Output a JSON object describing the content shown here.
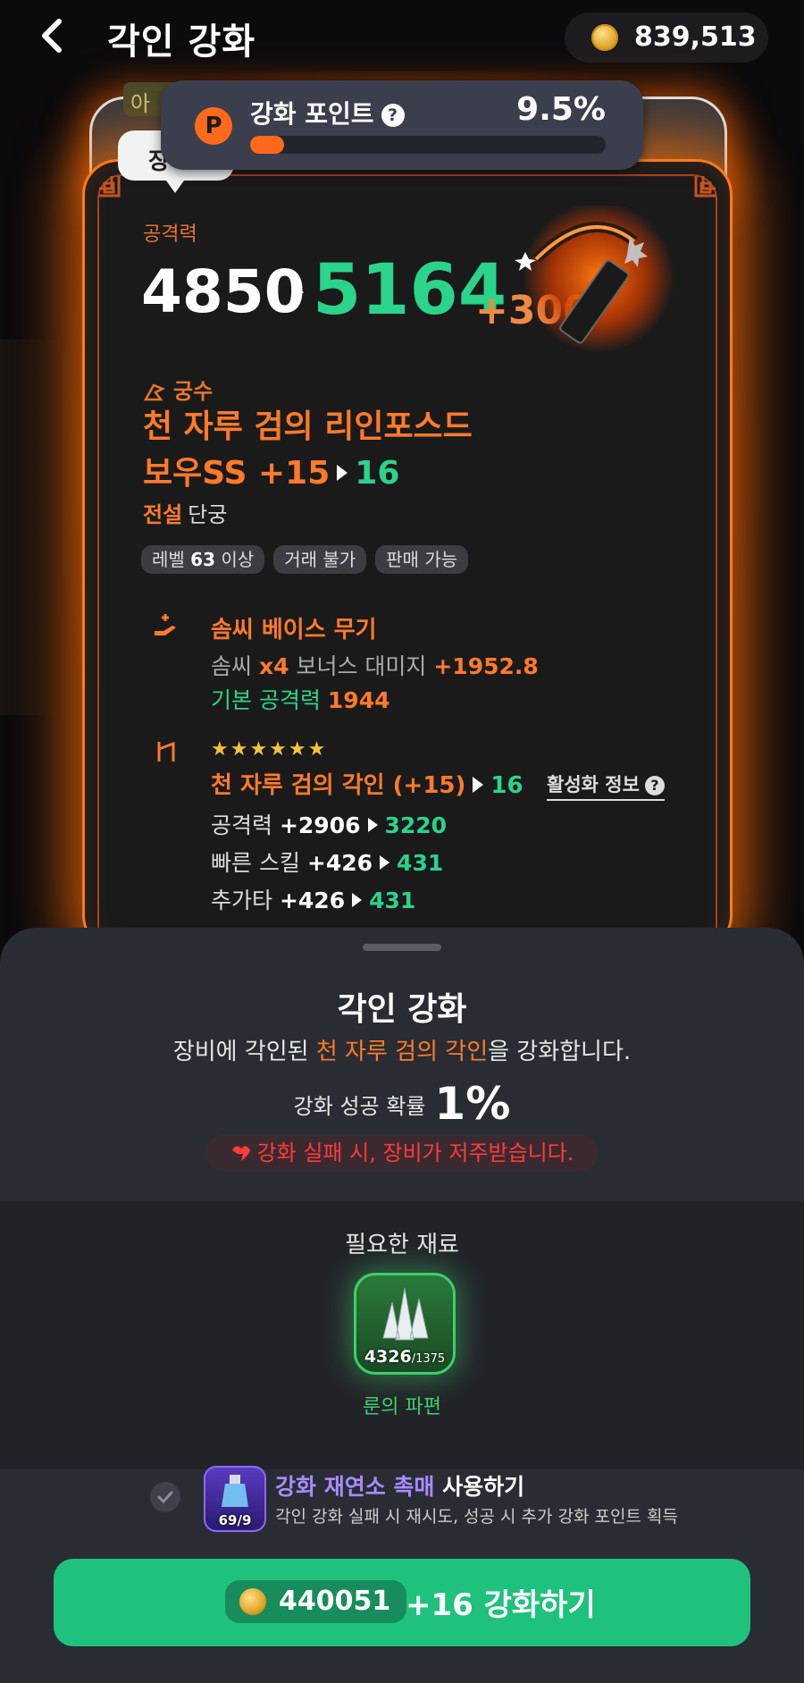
{
  "header": {
    "title": "각인 강화",
    "coins": "839,513"
  },
  "card": {
    "back_tag": "아",
    "tab_label": "장"
  },
  "points": {
    "icon": "P",
    "label": "강화 포인트",
    "value": "9.5%",
    "progress": 0.095
  },
  "weapon": {
    "attack_label": "공격력",
    "attack_old": "4850",
    "attack_new": "5164",
    "attack_bonus": "+300",
    "class_label": "궁수",
    "name_line1": "천 자루 검의 리인포스드",
    "name_line2_prefix": "보우SS +15",
    "name_line2_next": "16",
    "grade": "전설",
    "subtype": "단궁",
    "chips": {
      "level_prefix": "레벨",
      "level_value": "63",
      "level_suffix": "이상",
      "trade": "거래 불가",
      "sell": "판매 가능"
    }
  },
  "base_section": {
    "title": "솜씨 베이스 무기",
    "line1_a": "솜씨",
    "line1_b": "x4",
    "line1_c": "보너스 대미지",
    "line1_d": "+1952.8",
    "line2_a": "기본 공격력",
    "line2_b": "1944"
  },
  "engrave_section": {
    "stars": "★★★★★★",
    "title": "천 자루 검의 각인 (+15)",
    "title_next": "16",
    "info_link": "활성화 정보",
    "stats": [
      {
        "name": "공격력",
        "old": "+2906",
        "new": "3220"
      },
      {
        "name": "빠른 스킬",
        "old": "+426",
        "new": "431"
      },
      {
        "name": "추가타",
        "old": "+426",
        "new": "431"
      }
    ]
  },
  "sheet": {
    "title": "각인 강화",
    "desc_a": "장비에 각인된 ",
    "desc_b": "천 자루 검의 각인",
    "desc_c": "을 강화합니다.",
    "rate_label": "강화 성공 확률",
    "rate_value": "1%",
    "warning": "강화 실패 시, 장비가 저주받습니다."
  },
  "materials": {
    "title": "필요한 재료",
    "count": "4326",
    "required": "/1375",
    "name": "룬의 파편"
  },
  "catalyst": {
    "count": "69/9",
    "title_a": "강화 재연소 촉매",
    "title_b": " 사용하기",
    "desc": "각인 강화 실패 시 재시도, 성공 시 추가 강화 포인트 획득"
  },
  "action": {
    "cost": "440051",
    "label": "+16 강화하기"
  },
  "colors": {
    "accent_orange": "#ff7a2a",
    "accent_green": "#2ad48a",
    "button_green": "#1fc27d"
  }
}
